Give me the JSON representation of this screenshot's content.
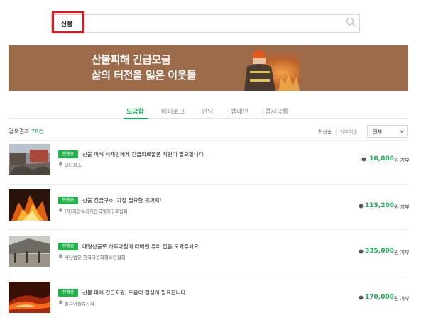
{
  "search": {
    "query": "산불"
  },
  "banner": {
    "line1": "산불피해 긴급모금",
    "line2": "삶의 터전을 잃은 이웃들"
  },
  "tabs": [
    {
      "label": "모금함",
      "active": true
    },
    {
      "label": "해피로그"
    },
    {
      "label": "펀딩"
    },
    {
      "label": "캠페인"
    },
    {
      "label": "콩저금통"
    }
  ],
  "results": {
    "label": "검색결과",
    "count": "78건"
  },
  "sort": {
    "option1": "최신순",
    "option2": "기부액순"
  },
  "filter": {
    "selected": "전체"
  },
  "items": [
    {
      "badge": "진행중",
      "title": "산불 피해 이재민에게 긴급의료물품 지원이 필요합니다.",
      "org": "비다피스",
      "amount": "10,000",
      "unit": "원 기부"
    },
    {
      "badge": "진행중",
      "title": "산불 긴급구호, 가장 필요한 곳까지!",
      "org": "(재)희망브리지전국재해구호협회",
      "amount": "115,200",
      "unit": "원 기부"
    },
    {
      "badge": "진행중",
      "title": "대형산불로 하루아침에 타버린 우리 집을 도와주세요.",
      "org": "사단법인 한국다문화청소년협회",
      "amount": "335,000",
      "unit": "원 기부"
    },
    {
      "badge": "진행중",
      "title": "산불 피해 긴급지원, 도움이 절실히 필요합니다.",
      "org": "홀트아동복지회",
      "amount": "170,000",
      "unit": "원 기부"
    }
  ],
  "colors": {
    "accent": "#1aaa55",
    "badge": "#22b24c",
    "highlight": "#e3141b",
    "banner": "#9b6b4a"
  }
}
